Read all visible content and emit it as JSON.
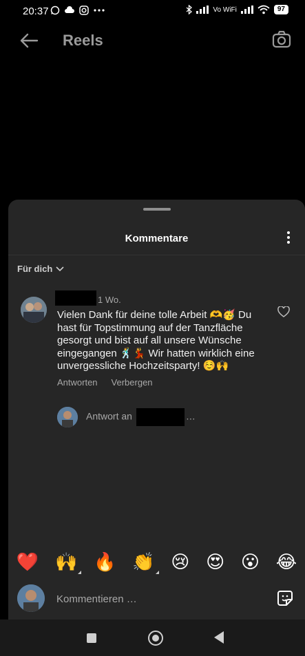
{
  "status_bar": {
    "time": "20:37",
    "icons_left": [
      "whatsapp-icon",
      "cloud-icon",
      "instagram-icon",
      "more-icon"
    ],
    "network_label": "Vo WiFi",
    "battery": "97"
  },
  "header": {
    "title": "Reels",
    "back_icon": "arrow-left-icon",
    "camera_icon": "camera-icon"
  },
  "comments_sheet": {
    "title": "Kommentare",
    "sort_label": "Für dich",
    "comment": {
      "time": "1 Wo.",
      "text": "Vielen Dank für deine tolle Arbeit 🫶🥳 Du hast für Topstimmung auf der Tanzfläche gesorgt und bist auf all unsere Wünsche eingegangen 🕺💃 Wir hatten wirklich eine unvergessliche Hochzeitsparty! ☺️🙌",
      "reply_label": "Antworten",
      "hide_label": "Verbergen"
    },
    "reply_prompt": {
      "prefix": "Antwort an",
      "suffix": "…"
    },
    "quick_reactions": [
      "❤️",
      "🙌",
      "🔥",
      "👏",
      "😢",
      "😍",
      "😮",
      "😂"
    ],
    "composer_placeholder": "Kommentieren …"
  },
  "colors": {
    "background": "#000000",
    "sheet": "#262626",
    "muted_text": "#a8a8a8"
  }
}
